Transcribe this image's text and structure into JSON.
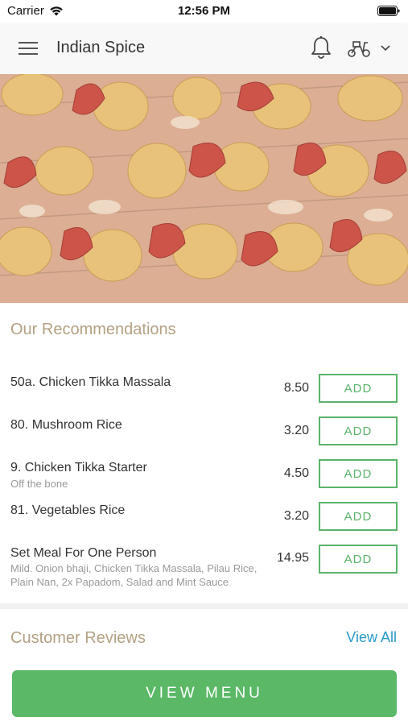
{
  "status_bar": {
    "carrier": "Carrier",
    "time": "12:56 PM"
  },
  "header": {
    "title": "Indian Spice",
    "icons": [
      "menu-icon",
      "bell-icon",
      "scooter-icon",
      "chevron-down-icon"
    ]
  },
  "recommendations": {
    "title": "Our Recommendations",
    "items": [
      {
        "name": "50a. Chicken Tikka Massala",
        "description": "",
        "price": "8.50",
        "button": "ADD"
      },
      {
        "name": "80. Mushroom Rice",
        "description": "",
        "price": "3.20",
        "button": "ADD"
      },
      {
        "name": "9. Chicken Tikka Starter",
        "description": "Off the bone",
        "price": "4.50",
        "button": "ADD"
      },
      {
        "name": "81. Vegetables Rice",
        "description": "",
        "price": "3.20",
        "button": "ADD"
      },
      {
        "name": "Set Meal For One Person",
        "description": "Mild. Onion bhaji, Chicken Tikka Massala, Pilau Rice, Plain Nan, 2x Papadom, Salad and Mint Sauce",
        "price": "14.95",
        "button": "ADD"
      }
    ]
  },
  "reviews": {
    "title": "Customer Reviews",
    "view_all": "View All"
  },
  "footer": {
    "view_menu": "VIEW MENU"
  },
  "colors": {
    "accent_green": "#5bb36a",
    "section_title": "#b3a184",
    "link_blue": "#2b9bc9"
  }
}
